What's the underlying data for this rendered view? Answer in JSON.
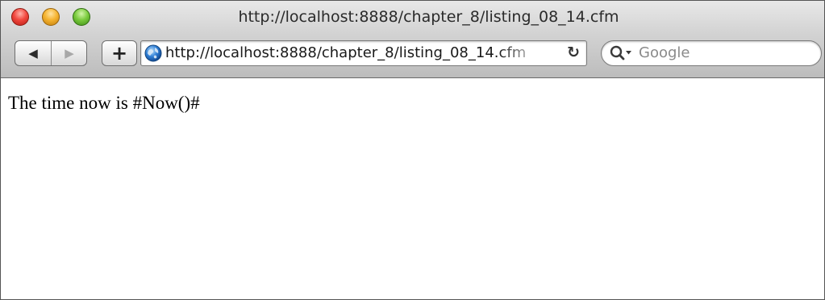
{
  "window": {
    "title": "http://localhost:8888/chapter_8/listing_08_14.cfm"
  },
  "toolbar": {
    "back_icon": "◀",
    "forward_icon": "▶",
    "add_bookmark_label": "+",
    "address": "http://localhost:8888/chapter_8/listing_08_14.cfm",
    "reload_icon": "↻",
    "search_placeholder": "Google"
  },
  "icons": {
    "back": "back-arrow-icon",
    "forward": "forward-arrow-icon",
    "site": "globe-icon",
    "reload": "reload-icon",
    "search": "magnifier-dropdown-icon"
  },
  "page": {
    "body_text": "The time now is #Now()#"
  },
  "colors": {
    "close": "#f2483f",
    "minimize": "#f6b431",
    "zoom": "#7ccc3f",
    "globe": "#2f7fd6"
  }
}
